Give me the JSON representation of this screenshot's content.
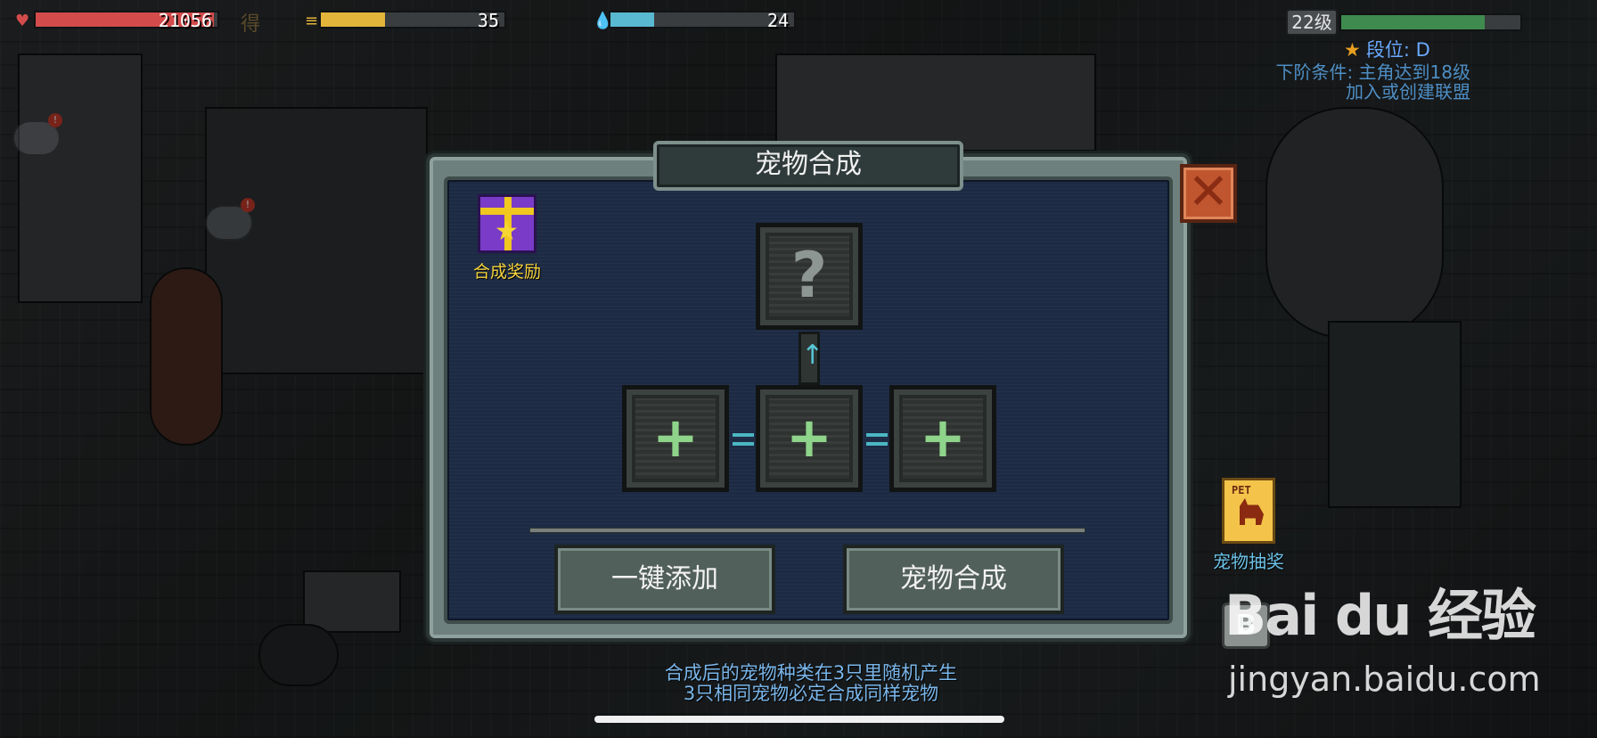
{
  "hud": {
    "health": {
      "value": "21056",
      "fill": 0.98,
      "color": "#d34b4b",
      "icon": "heart-icon"
    },
    "food": {
      "value": "35",
      "fill": 0.35,
      "color": "#e3b53a",
      "icon": "burger-icon"
    },
    "water": {
      "value": "24",
      "fill": 0.24,
      "color": "#58b9d0",
      "icon": "water-drop-icon"
    },
    "faded_text": "得"
  },
  "player": {
    "level": "22级",
    "xp_fill": 0.8,
    "rank_label": "段位: D",
    "next_rank_conditions": [
      "下阶条件: 主角达到18级",
      "加入或创建联盟"
    ]
  },
  "dialog": {
    "title": "宠物合成",
    "reward_label": "合成奖励",
    "result_slot_glyph": "?",
    "input_slot_glyph": "+",
    "buttons": {
      "auto_add": "一键添加",
      "synthesize": "宠物合成"
    }
  },
  "side": {
    "pet_draw_label": "宠物抽奖",
    "pet_scroll_text": "PET"
  },
  "footnote": {
    "line1": "合成后的宠物种类在3只里随机产生",
    "line2": "3只相同宠物必定合成同样宠物"
  },
  "watermark": {
    "brand": "Bai du 经验",
    "url": "jingyan.baidu.com"
  },
  "colors": {
    "accent_cyan": "#4cb7c4",
    "plus_green": "#8ed48a",
    "close_red": "#c0562f",
    "panel_navy": "#1c2a44"
  }
}
